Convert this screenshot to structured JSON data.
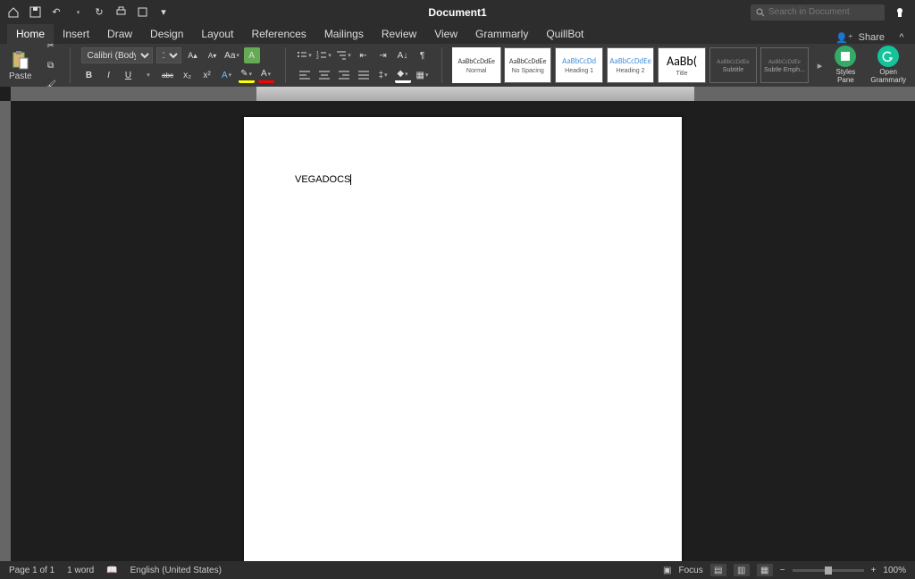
{
  "title": "Document1",
  "search": {
    "placeholder": "Search in Document"
  },
  "qat": {
    "home": "⌂",
    "save": "💾",
    "undo": "↶",
    "redo": "↻",
    "print": "⎙",
    "touch": "☐",
    "more": "▾"
  },
  "tabs": [
    "Home",
    "Insert",
    "Draw",
    "Design",
    "Layout",
    "References",
    "Mailings",
    "Review",
    "View",
    "Grammarly",
    "QuillBot"
  ],
  "active_tab": 0,
  "share_label": "Share",
  "paste": {
    "label": "Paste"
  },
  "font": {
    "name": "Calibri (Body)",
    "size": "12"
  },
  "fontbtns": {
    "grow": "A▴",
    "shrink": "A▾",
    "clear": "Aₐ",
    "aa": "Aa",
    "eraser": "◇"
  },
  "format": {
    "bold": "B",
    "italic": "I",
    "underline": "U",
    "strike": "abc",
    "sub": "x₂",
    "sup": "x²",
    "Acolor": "A",
    "highlight": "✎",
    "fontcolor": "A"
  },
  "para": {
    "ul": "≣",
    "ol": "≣",
    "ml": "≣",
    "dedent": "⇤",
    "indent": "⇥",
    "sort": "↕",
    "pilcrow": "¶",
    "al": "≡",
    "ac": "≡",
    "ar": "≡",
    "aj": "≡",
    "ls": "≡",
    "shade": "◆",
    "border": "▦"
  },
  "styles": [
    {
      "preview": "AaBbCcDdEe",
      "name": "Normal",
      "cls": ""
    },
    {
      "preview": "AaBbCcDdEe",
      "name": "No Spacing",
      "cls": ""
    },
    {
      "preview": "AaBbCcDd",
      "name": "Heading 1",
      "cls": "blue"
    },
    {
      "preview": "AaBbCcDdEe",
      "name": "Heading 2",
      "cls": "blue"
    },
    {
      "preview": "AaBb(",
      "name": "Title",
      "cls": "big"
    },
    {
      "preview": "AaBbCcDdEe",
      "name": "Subtitle",
      "cls": "gray"
    },
    {
      "preview": "AaBbCcDdEe",
      "name": "Subtle Emph...",
      "cls": "italic"
    }
  ],
  "styles_pane": {
    "label": "Styles\nPane"
  },
  "grammarly_btn": {
    "label": "Open\nGrammarly"
  },
  "document": {
    "text": "VEGADOCS"
  },
  "status": {
    "page": "Page 1 of 1",
    "words": "1 word",
    "lang": "English (United States)",
    "focus": "Focus",
    "zoom": "100%"
  }
}
